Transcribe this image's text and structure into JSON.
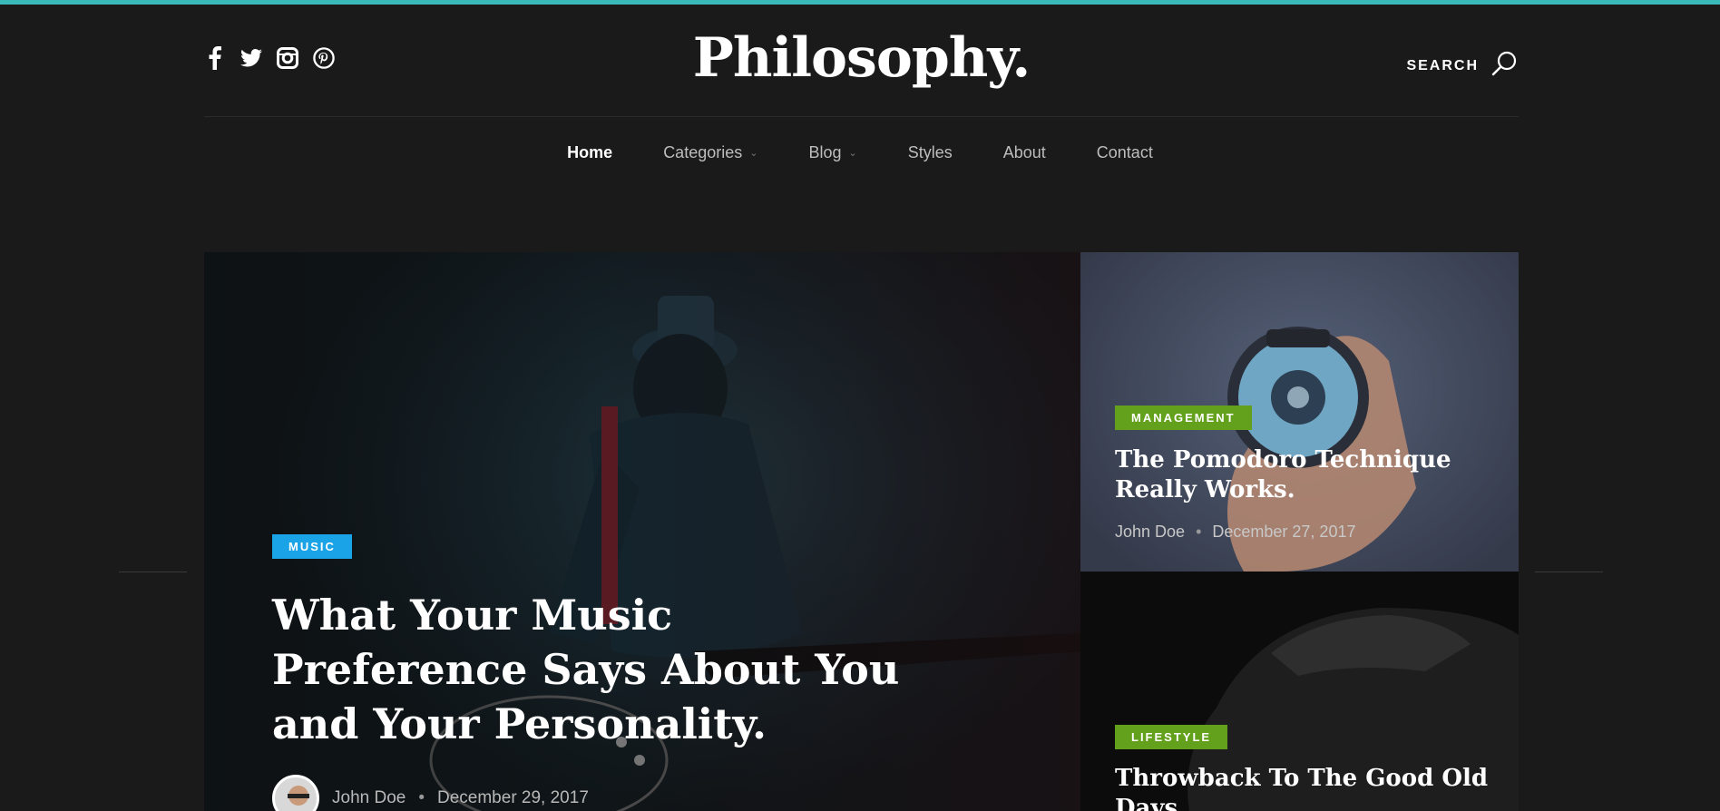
{
  "brand": {
    "name": "Philosophy.",
    "accent": "#39b9b9"
  },
  "social": [
    {
      "icon": "facebook-icon"
    },
    {
      "icon": "twitter-icon"
    },
    {
      "icon": "instagram-icon"
    },
    {
      "icon": "pinterest-icon"
    }
  ],
  "search": {
    "label": "SEARCH",
    "icon": "search-icon"
  },
  "nav": {
    "items": [
      {
        "label": "Home",
        "active": true
      },
      {
        "label": "Categories",
        "dropdown": true
      },
      {
        "label": "Blog",
        "dropdown": true
      },
      {
        "label": "Styles"
      },
      {
        "label": "About"
      },
      {
        "label": "Contact"
      }
    ]
  },
  "featured": {
    "main": {
      "category": "MUSIC",
      "category_color": "#1aa3e6",
      "title": "What Your Music Preference Says About You and Your Personality.",
      "author": "John Doe",
      "date": "December 29, 2017"
    },
    "side": [
      {
        "category": "MANAGEMENT",
        "category_color": "#63a01b",
        "title": "The Pomodoro Technique Really Works.",
        "author": "John Doe",
        "date": "December 27, 2017"
      },
      {
        "category": "LIFESTYLE",
        "category_color": "#63a01b",
        "title": "Throwback To The Good Old Days."
      }
    ]
  }
}
